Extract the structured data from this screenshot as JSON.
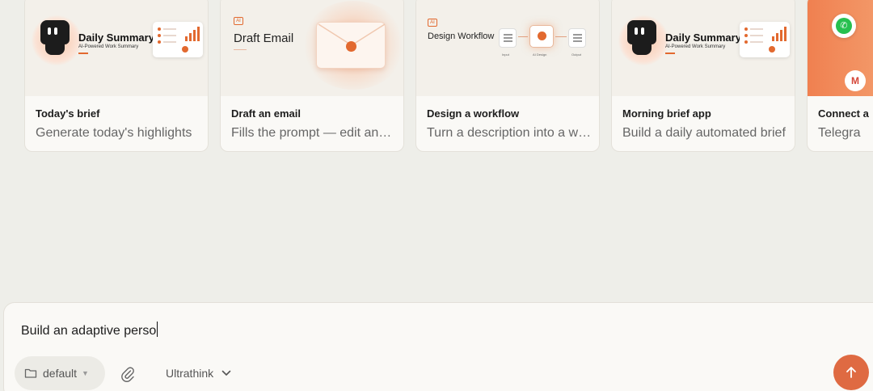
{
  "cards": [
    {
      "title": "Today's brief",
      "description": "Generate today's highlights",
      "thumb": {
        "heading": "Daily Summary",
        "subheading": "AI-Powered Work Summary"
      }
    },
    {
      "title": "Draft an email",
      "description": "Fills the prompt — edit and send",
      "thumb": {
        "tag": "AI",
        "heading": "Draft Email"
      }
    },
    {
      "title": "Design a workflow",
      "description": "Turn a description into a workflow",
      "thumb": {
        "tag": "AI",
        "heading": "Design Workflow",
        "nodes": [
          "Input",
          "AI Design",
          "Output"
        ]
      }
    },
    {
      "title": "Morning brief app",
      "description": "Build a daily automated brief",
      "thumb": {
        "heading": "Daily Summary",
        "subheading": "AI-Powered Work Summary"
      }
    },
    {
      "title": "Connect a",
      "description": "Telegra"
    }
  ],
  "composer": {
    "input_value": "Build an adaptive perso",
    "folder_label": "default",
    "thinking_mode": "Ultrathink"
  },
  "colors": {
    "accent": "#df6a42",
    "background": "#eeeee9",
    "card": "#faf9f6"
  }
}
